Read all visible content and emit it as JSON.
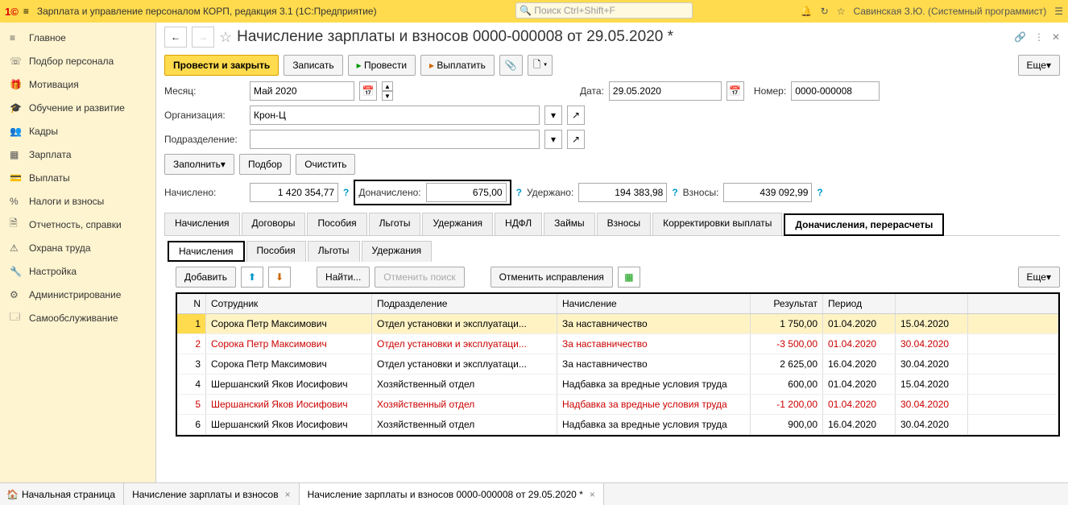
{
  "top": {
    "app_title": "Зарплата и управление персоналом КОРП, редакция 3.1  (1С:Предприятие)",
    "search_placeholder": "Поиск Ctrl+Shift+F",
    "user": "Савинская З.Ю. (Системный программист)"
  },
  "sidebar": [
    {
      "icon": "≡",
      "label": "Главное"
    },
    {
      "icon": "☏",
      "label": "Подбор персонала"
    },
    {
      "icon": "🎁",
      "label": "Мотивация"
    },
    {
      "icon": "🎓",
      "label": "Обучение и развитие"
    },
    {
      "icon": "👥",
      "label": "Кадры"
    },
    {
      "icon": "▦",
      "label": "Зарплата"
    },
    {
      "icon": "💳",
      "label": "Выплаты"
    },
    {
      "icon": "%",
      "label": "Налоги и взносы"
    },
    {
      "icon": "🗎",
      "label": "Отчетность, справки"
    },
    {
      "icon": "⚠",
      "label": "Охрана труда"
    },
    {
      "icon": "🔧",
      "label": "Настройка"
    },
    {
      "icon": "⚙",
      "label": "Администрирование"
    },
    {
      "icon": "🗔",
      "label": "Самообслуживание"
    }
  ],
  "doc_title": "Начисление зарплаты и взносов 0000-000008 от 29.05.2020 *",
  "cmd": {
    "post_close": "Провести и закрыть",
    "save": "Записать",
    "post": "Провести",
    "pay": "Выплатить",
    "more": "Еще"
  },
  "form": {
    "month_lbl": "Месяц:",
    "month_val": "Май 2020",
    "date_lbl": "Дата:",
    "date_val": "29.05.2020",
    "num_lbl": "Номер:",
    "num_val": "0000-000008",
    "org_lbl": "Организация:",
    "org_val": "Крон-Ц",
    "dep_lbl": "Подразделение:",
    "dep_val": "",
    "fill": "Заполнить",
    "select": "Подбор",
    "clear": "Очистить",
    "accrued_lbl": "Начислено:",
    "accrued_val": "1 420 354,77",
    "extra_lbl": "Доначислено:",
    "extra_val": "675,00",
    "withheld_lbl": "Удержано:",
    "withheld_val": "194 383,98",
    "contrib_lbl": "Взносы:",
    "contrib_val": "439 092,99"
  },
  "tabs": [
    "Начисления",
    "Договоры",
    "Пособия",
    "Льготы",
    "Удержания",
    "НДФЛ",
    "Займы",
    "Взносы",
    "Корректировки выплаты",
    "Доначисления, перерасчеты"
  ],
  "subtabs": [
    "Начисления",
    "Пособия",
    "Льготы",
    "Удержания"
  ],
  "tbl_toolbar": {
    "add": "Добавить",
    "find": "Найти...",
    "cancel_search": "Отменить поиск",
    "cancel_fix": "Отменить исправления",
    "more": "Еще"
  },
  "grid": {
    "head": {
      "n": "N",
      "emp": "Сотрудник",
      "dep": "Подразделение",
      "acc": "Начисление",
      "res": "Результат",
      "period": "Период"
    },
    "rows": [
      {
        "n": "1",
        "emp": "Сорока Петр Максимович",
        "dep": "Отдел установки и эксплуатаци...",
        "acc": "За наставничество",
        "res": "1 750,00",
        "p1": "01.04.2020",
        "p2": "15.04.2020",
        "red": false,
        "sel": true
      },
      {
        "n": "2",
        "emp": "Сорока Петр Максимович",
        "dep": "Отдел установки и эксплуатаци...",
        "acc": "За наставничество",
        "res": "-3 500,00",
        "p1": "01.04.2020",
        "p2": "30.04.2020",
        "red": true
      },
      {
        "n": "3",
        "emp": "Сорока Петр Максимович",
        "dep": "Отдел установки и эксплуатаци...",
        "acc": "За наставничество",
        "res": "2 625,00",
        "p1": "16.04.2020",
        "p2": "30.04.2020",
        "red": false
      },
      {
        "n": "4",
        "emp": "Шершанский Яков Иосифович",
        "dep": "Хозяйственный отдел",
        "acc": "Надбавка за вредные условия труда",
        "res": "600,00",
        "p1": "01.04.2020",
        "p2": "15.04.2020",
        "red": false
      },
      {
        "n": "5",
        "emp": "Шершанский Яков Иосифович",
        "dep": "Хозяйственный отдел",
        "acc": "Надбавка за вредные условия труда",
        "res": "-1 200,00",
        "p1": "01.04.2020",
        "p2": "30.04.2020",
        "red": true
      },
      {
        "n": "6",
        "emp": "Шершанский Яков Иосифович",
        "dep": "Хозяйственный отдел",
        "acc": "Надбавка за вредные условия труда",
        "res": "900,00",
        "p1": "16.04.2020",
        "p2": "30.04.2020",
        "red": false
      }
    ]
  },
  "bottom": {
    "home": "Начальная страница",
    "t1": "Начисление зарплаты и взносов",
    "t2": "Начисление зарплаты и взносов 0000-000008 от 29.05.2020 *"
  }
}
